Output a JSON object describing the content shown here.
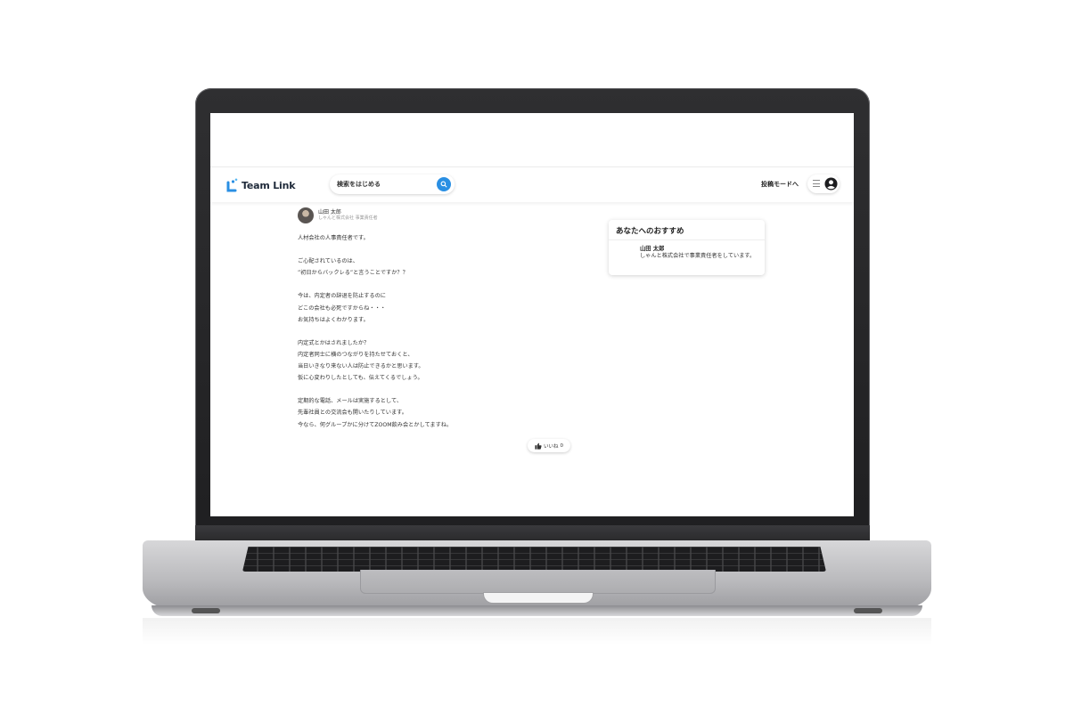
{
  "app": {
    "logo_text": "Team Link",
    "brand_color": "#2a8fe3"
  },
  "header": {
    "search_placeholder": "検索をはじめる",
    "post_mode_label": "投稿モードへ",
    "icons": [
      "search-icon",
      "hamburger-icon",
      "account-icon"
    ]
  },
  "post": {
    "author_name": "山田 太郎",
    "author_role": "しゃんと株式会社 事業責任者",
    "lines": [
      "人材会社の人事責任者です。",
      "",
      "ご心配されているのは、",
      "”初日からバックレる”と言うことですか？？",
      "",
      "今は、内定者の辞退を防止するのに",
      "どこの会社も必死ですからね・・・",
      "お気持ちはよくわかります。",
      "",
      "内定式とかはされましたか？",
      "内定者同士に横のつながりを持たせておくと、",
      "当日いきなり来ない人は防止できるかと思います。",
      "仮に心変わりしたとしても、伝えてくるでしょう。",
      "",
      "定期的な電話、メールは実施するとして、",
      "先輩社員との交流会も開いたりしています。",
      "今なら、何グループかに分けてZOOM飲み会とかしてますね。"
    ],
    "like_label": "いいね",
    "like_count": "0"
  },
  "recommend": {
    "title": "あなたへのおすすめ",
    "name": "山田 太郎",
    "description": "しゃんと株式会社で事業責任者をしています。"
  }
}
